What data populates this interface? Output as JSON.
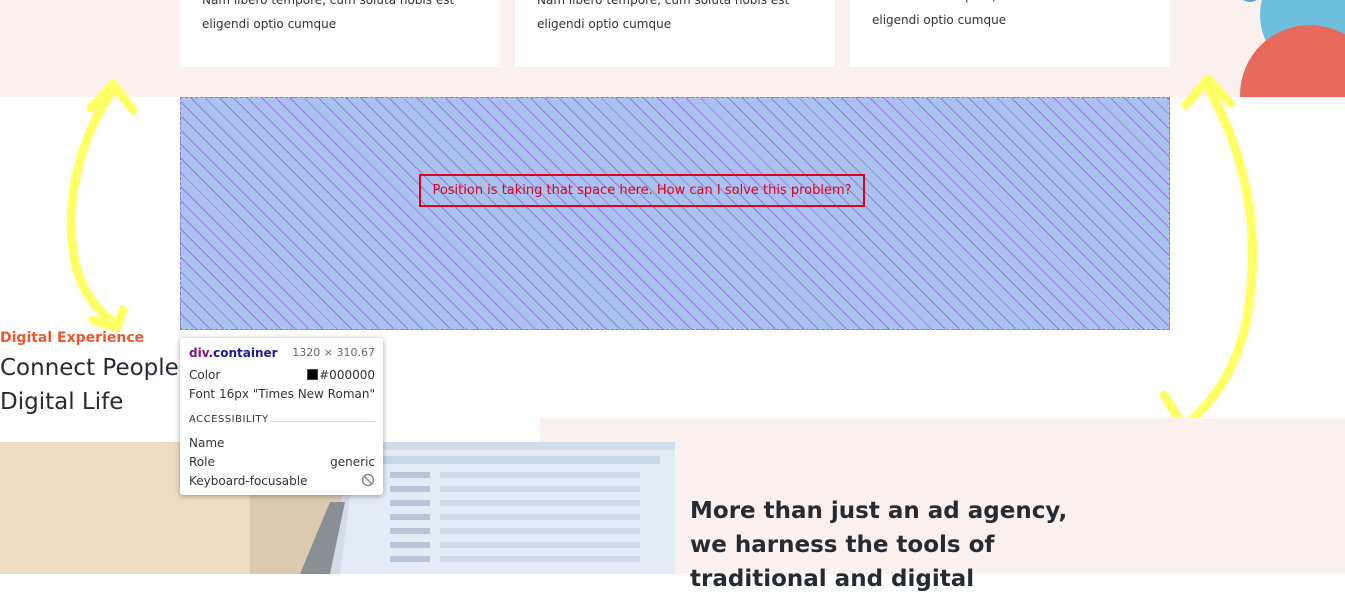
{
  "cards": [
    {
      "line1": "Nam libero tempore, cum soluta nobis est",
      "line2": "eligendi optio cumque"
    },
    {
      "line1": "Nam libero tempore, cum soluta nobis est",
      "line2": "eligendi optio cumque"
    },
    {
      "line1": "Nam libero tempore, cum soluta nobis est",
      "line2": "eligendi optio cumque"
    }
  ],
  "annotation": {
    "text": "Position is taking that space here. How can I solve this problem?",
    "box_color": "#e0001a",
    "arrow_color": "#ffff66"
  },
  "section": {
    "eyebrow": "Digital Experience",
    "heading_line1": "Connect People",
    "heading_line2": "Digital Life",
    "big_line1": "More than just an ad agency,",
    "big_line2": "we harness the tools of",
    "big_line3": "traditional and digital"
  },
  "inspector": {
    "tag": "div",
    "class": ".container",
    "size": "1320 × 310.67",
    "color_label": "Color",
    "color_value": "#000000",
    "font_label": "Font",
    "font_value": "16px \"Times New Roman\"",
    "accessibility_label": "ACCESSIBILITY",
    "name_label": "Name",
    "role_label": "Role",
    "role_value": "generic",
    "focusable_label": "Keyboard-focusable",
    "focusable_icon": "not-allowed-icon"
  },
  "colors": {
    "accent": "#f0562d",
    "highlight_fill": "#a9c3ee",
    "section_bg": "#faf1ee",
    "heading_text": "#262a33"
  }
}
